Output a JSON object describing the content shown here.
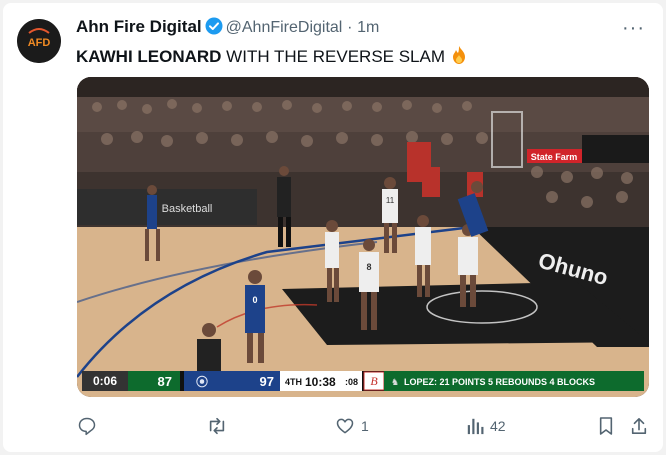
{
  "tweet": {
    "avatar_text": "AFD",
    "name": "Ahn Fire Digital",
    "handle": "@AhnFireDigital",
    "separator": "·",
    "time": "1m",
    "text_bold": "KAWHI LEONARD",
    "text_rest": " WITH THE REVERSE SLAM",
    "more_label": "···"
  },
  "scoreboard": {
    "shot_clock": "0:06",
    "home_score": "87",
    "away_score": "97",
    "period": "4TH",
    "game_clock": "10:38",
    "shot_clock_small": ":08",
    "stat_line": "LOPEZ: 21 POINTS   5 REBOUNDS   4 BLOCKS"
  },
  "arena": {
    "banner_left": "Basketball",
    "banner_right": "State Farm",
    "baseline_logo": "Ohuno",
    "jersey_numbers": [
      "11",
      "8",
      "0"
    ]
  },
  "actions": {
    "replies": "",
    "reposts": "",
    "likes": "1",
    "views": "42",
    "bookmark": "",
    "share": ""
  },
  "colors": {
    "verified": "#1d9bf0",
    "bucks_green": "#0d6b2d",
    "clippers_blue": "#1d428a",
    "key_black": "#1c1c1c",
    "court": "#d8b48c"
  }
}
